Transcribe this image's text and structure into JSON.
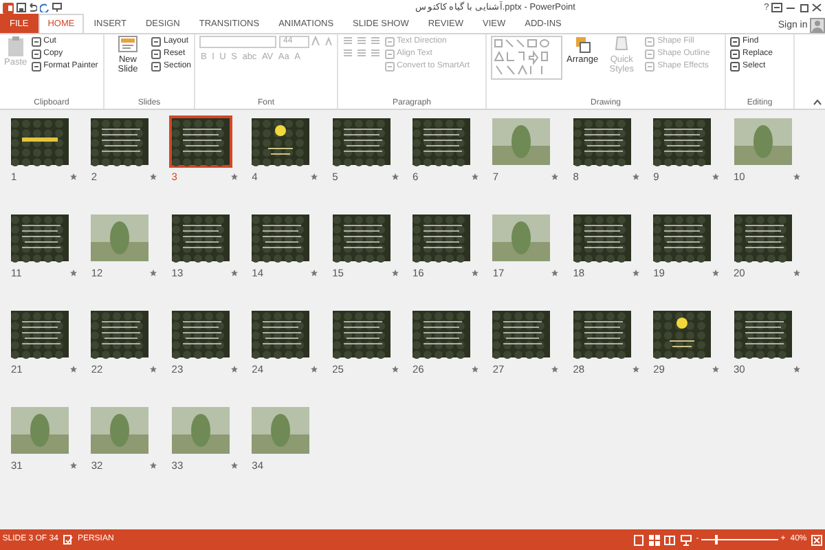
{
  "title_bar": {
    "title": "آشنایی با گیاه کاکتوس.pptx - PowerPoint",
    "help": "?",
    "sign_in": "Sign in"
  },
  "tabs": [
    {
      "label": "FILE",
      "kind": "file",
      "selected": false
    },
    {
      "label": "HOME",
      "kind": "tab",
      "selected": true
    },
    {
      "label": "INSERT",
      "kind": "tab",
      "selected": false
    },
    {
      "label": "DESIGN",
      "kind": "tab",
      "selected": false
    },
    {
      "label": "TRANSITIONS",
      "kind": "tab",
      "selected": false
    },
    {
      "label": "ANIMATIONS",
      "kind": "tab",
      "selected": false
    },
    {
      "label": "SLIDE SHOW",
      "kind": "tab",
      "selected": false
    },
    {
      "label": "REVIEW",
      "kind": "tab",
      "selected": false
    },
    {
      "label": "VIEW",
      "kind": "tab",
      "selected": false
    },
    {
      "label": "ADD-INS",
      "kind": "tab",
      "selected": false
    }
  ],
  "ribbon": {
    "clipboard": {
      "label": "Clipboard",
      "paste": {
        "label": "Paste",
        "disabled": true
      },
      "items": [
        {
          "label": "Cut",
          "disabled": false
        },
        {
          "label": "Copy",
          "disabled": false
        },
        {
          "label": "Format Painter",
          "disabled": false
        }
      ]
    },
    "slides": {
      "label": "Slides",
      "new_slide": {
        "label": "New Slide",
        "disabled": false
      },
      "items": [
        {
          "label": "Layout",
          "disabled": false
        },
        {
          "label": "Reset",
          "disabled": false
        },
        {
          "label": "Section",
          "disabled": false
        }
      ]
    },
    "font": {
      "label": "Font",
      "size": "44",
      "buttons": [
        "B",
        "I",
        "U",
        "S",
        "abc",
        "AV",
        "Aa",
        "A"
      ]
    },
    "paragraph": {
      "label": "Paragraph",
      "items": [
        {
          "label": "Text Direction",
          "disabled": true
        },
        {
          "label": "Align Text",
          "disabled": true
        },
        {
          "label": "Convert to SmartArt",
          "disabled": true
        }
      ]
    },
    "drawing": {
      "label": "Drawing",
      "large": [
        {
          "label": "Arrange",
          "disabled": false
        },
        {
          "label": "Quick Styles",
          "disabled": true
        }
      ],
      "items": [
        {
          "label": "Shape Fill",
          "disabled": true
        },
        {
          "label": "Shape Outline",
          "disabled": true
        },
        {
          "label": "Shape Effects",
          "disabled": true
        }
      ]
    },
    "editing": {
      "label": "Editing",
      "items": [
        {
          "label": "Find",
          "disabled": false
        },
        {
          "label": "Replace",
          "disabled": false
        },
        {
          "label": "Select",
          "disabled": false
        }
      ]
    }
  },
  "slides": [
    {
      "number": "1",
      "kind": "title",
      "selected": false,
      "animated": true
    },
    {
      "number": "2",
      "kind": "text",
      "selected": false,
      "animated": true
    },
    {
      "number": "3",
      "kind": "text",
      "selected": true,
      "animated": true
    },
    {
      "number": "4",
      "kind": "flower",
      "selected": false,
      "animated": true
    },
    {
      "number": "5",
      "kind": "text",
      "selected": false,
      "animated": true
    },
    {
      "number": "6",
      "kind": "text",
      "selected": false,
      "animated": true
    },
    {
      "number": "7",
      "kind": "photo",
      "selected": false,
      "animated": true
    },
    {
      "number": "8",
      "kind": "text",
      "selected": false,
      "animated": true
    },
    {
      "number": "9",
      "kind": "text",
      "selected": false,
      "animated": true
    },
    {
      "number": "10",
      "kind": "photo",
      "selected": false,
      "animated": true
    },
    {
      "number": "11",
      "kind": "text",
      "selected": false,
      "animated": true
    },
    {
      "number": "12",
      "kind": "photo",
      "selected": false,
      "animated": true
    },
    {
      "number": "13",
      "kind": "text",
      "selected": false,
      "animated": true
    },
    {
      "number": "14",
      "kind": "text",
      "selected": false,
      "animated": true
    },
    {
      "number": "15",
      "kind": "text",
      "selected": false,
      "animated": true
    },
    {
      "number": "16",
      "kind": "text",
      "selected": false,
      "animated": true
    },
    {
      "number": "17",
      "kind": "photo",
      "selected": false,
      "animated": true
    },
    {
      "number": "18",
      "kind": "text",
      "selected": false,
      "animated": true
    },
    {
      "number": "19",
      "kind": "text",
      "selected": false,
      "animated": true
    },
    {
      "number": "20",
      "kind": "text",
      "selected": false,
      "animated": true
    },
    {
      "number": "21",
      "kind": "text",
      "selected": false,
      "animated": true
    },
    {
      "number": "22",
      "kind": "text",
      "selected": false,
      "animated": true
    },
    {
      "number": "23",
      "kind": "text",
      "selected": false,
      "animated": true
    },
    {
      "number": "24",
      "kind": "text",
      "selected": false,
      "animated": true
    },
    {
      "number": "25",
      "kind": "text",
      "selected": false,
      "animated": true
    },
    {
      "number": "26",
      "kind": "text",
      "selected": false,
      "animated": true
    },
    {
      "number": "27",
      "kind": "text",
      "selected": false,
      "animated": true
    },
    {
      "number": "28",
      "kind": "text",
      "selected": false,
      "animated": true
    },
    {
      "number": "29",
      "kind": "flower",
      "selected": false,
      "animated": true
    },
    {
      "number": "30",
      "kind": "text",
      "selected": false,
      "animated": true
    },
    {
      "number": "31",
      "kind": "photo",
      "selected": false,
      "animated": true
    },
    {
      "number": "32",
      "kind": "photo",
      "selected": false,
      "animated": true
    },
    {
      "number": "33",
      "kind": "photo",
      "selected": false,
      "animated": true
    },
    {
      "number": "34",
      "kind": "photo",
      "selected": false,
      "animated": false
    }
  ],
  "status_bar": {
    "slide_info": "SLIDE 3 OF 34",
    "language": "PERSIAN",
    "zoom": "40%",
    "zoom_out": "-",
    "zoom_in": "+",
    "zoom_slider": {
      "level": 0.2
    }
  }
}
